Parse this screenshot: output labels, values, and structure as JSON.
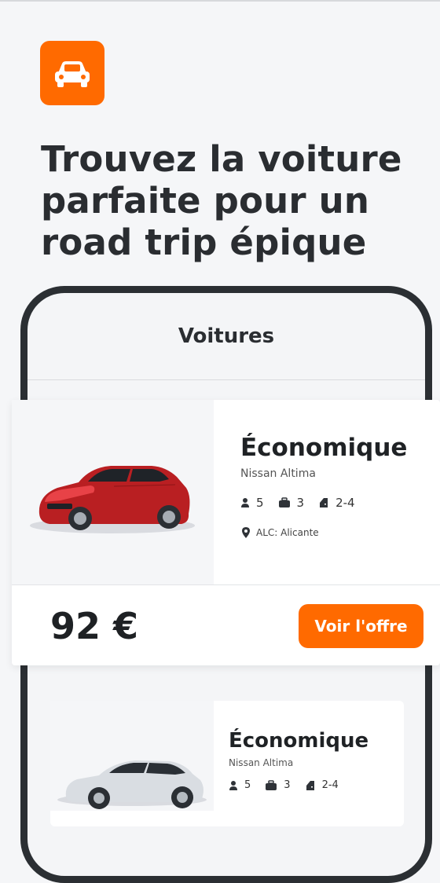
{
  "brand": {
    "icon": "car-icon",
    "accent": "#ff6a00"
  },
  "headline": {
    "lines": [
      "Trouvez la voiture",
      "parfaite pour un",
      "road trip épique"
    ]
  },
  "phone": {
    "title": "Voitures"
  },
  "card1": {
    "category": "Économique",
    "model": "Nissan Altima",
    "passengers": "5",
    "bags": "3",
    "doors": "2-4",
    "location": "ALC: Alicante",
    "price": "92 €",
    "cta": "Voir l'offre"
  },
  "card2": {
    "category": "Économique",
    "model": "Nissan Altima",
    "passengers": "5",
    "bags": "3",
    "doors": "2-4"
  }
}
